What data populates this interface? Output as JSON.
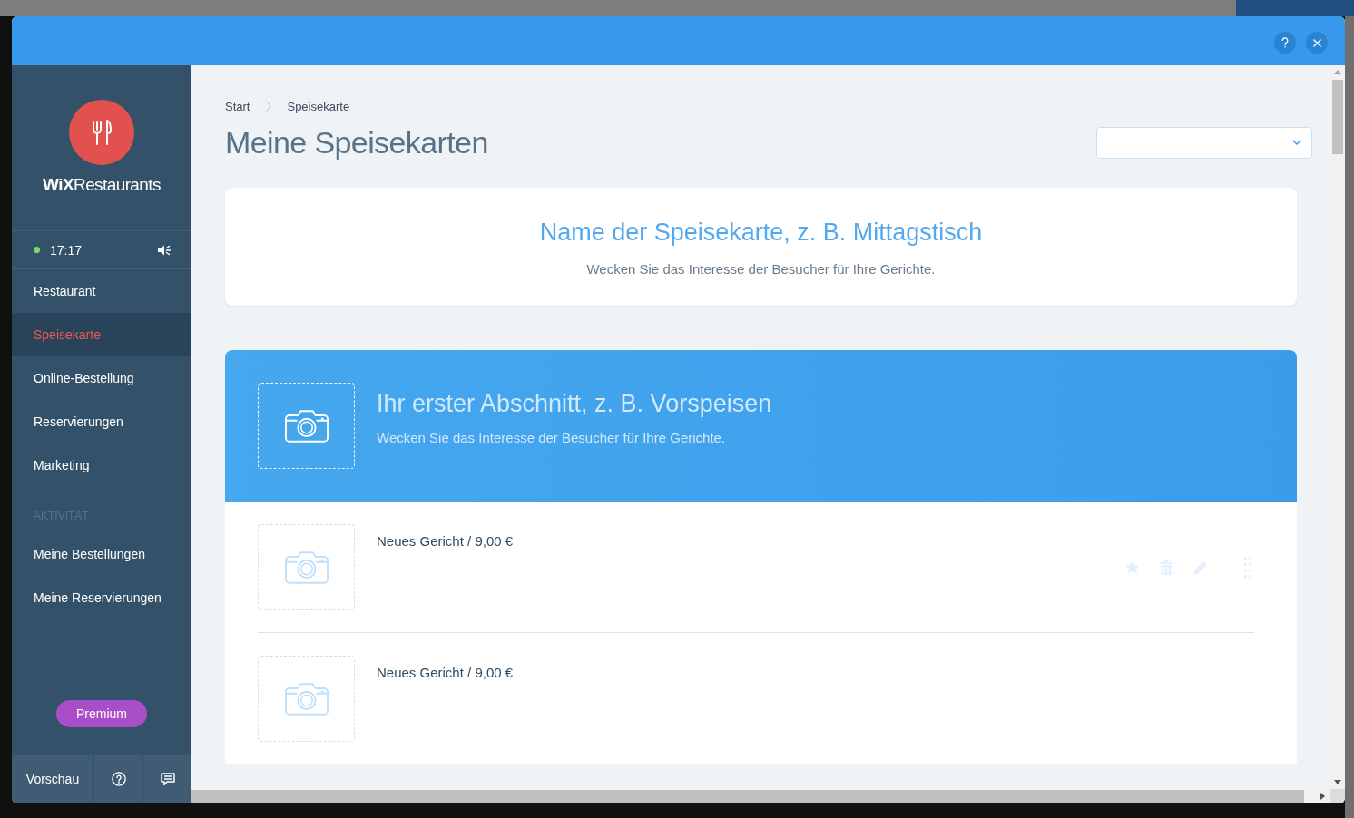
{
  "dialog": {
    "header_buttons": [
      {
        "kind": "help"
      },
      {
        "kind": "close"
      }
    ]
  },
  "sidebar": {
    "logo": "**WiX**Restaurants",
    "status": {
      "online": true,
      "time": "17:17",
      "sound_on": true
    },
    "nav": [
      {
        "label": "Restaurant",
        "selected": false
      },
      {
        "label": "Speisekarte",
        "selected": true
      },
      {
        "label": "Online-Bestellung",
        "selected": false
      },
      {
        "label": "Reservierungen",
        "selected": false
      },
      {
        "label": "Marketing",
        "selected": false
      }
    ],
    "activity_title": "AKTIVITÄT",
    "activity": [
      {
        "label": "Meine Bestellungen",
        "selected": false
      },
      {
        "label": "Meine Reservierungen",
        "selected": false
      }
    ],
    "premium_button": "Premium",
    "footer": [
      {
        "kind": "preview",
        "label": "Vorschau"
      },
      {
        "kind": "help"
      },
      {
        "kind": "chat"
      }
    ]
  },
  "main": {
    "breadcrumb": [
      "Start",
      "Speisekarte"
    ],
    "title": "Meine Speisekarten",
    "menu_card": {
      "title": "Name der Speisekarte, z. B. Mittagstisch",
      "description": "Wecken Sie das Interesse der Besucher für Ihre Gerichte."
    },
    "section": {
      "title": "Ihr erster Abschnitt, z. B. Vorspeisen",
      "description": "Wecken Sie das Interesse der Besucher für Ihre Gerichte.",
      "dishes": [
        {
          "name": "Neues Gericht / 9,00 €",
          "actions_visible": true
        },
        {
          "name": "Neues Gericht / 9,00 €",
          "actions_visible": false
        }
      ]
    }
  }
}
